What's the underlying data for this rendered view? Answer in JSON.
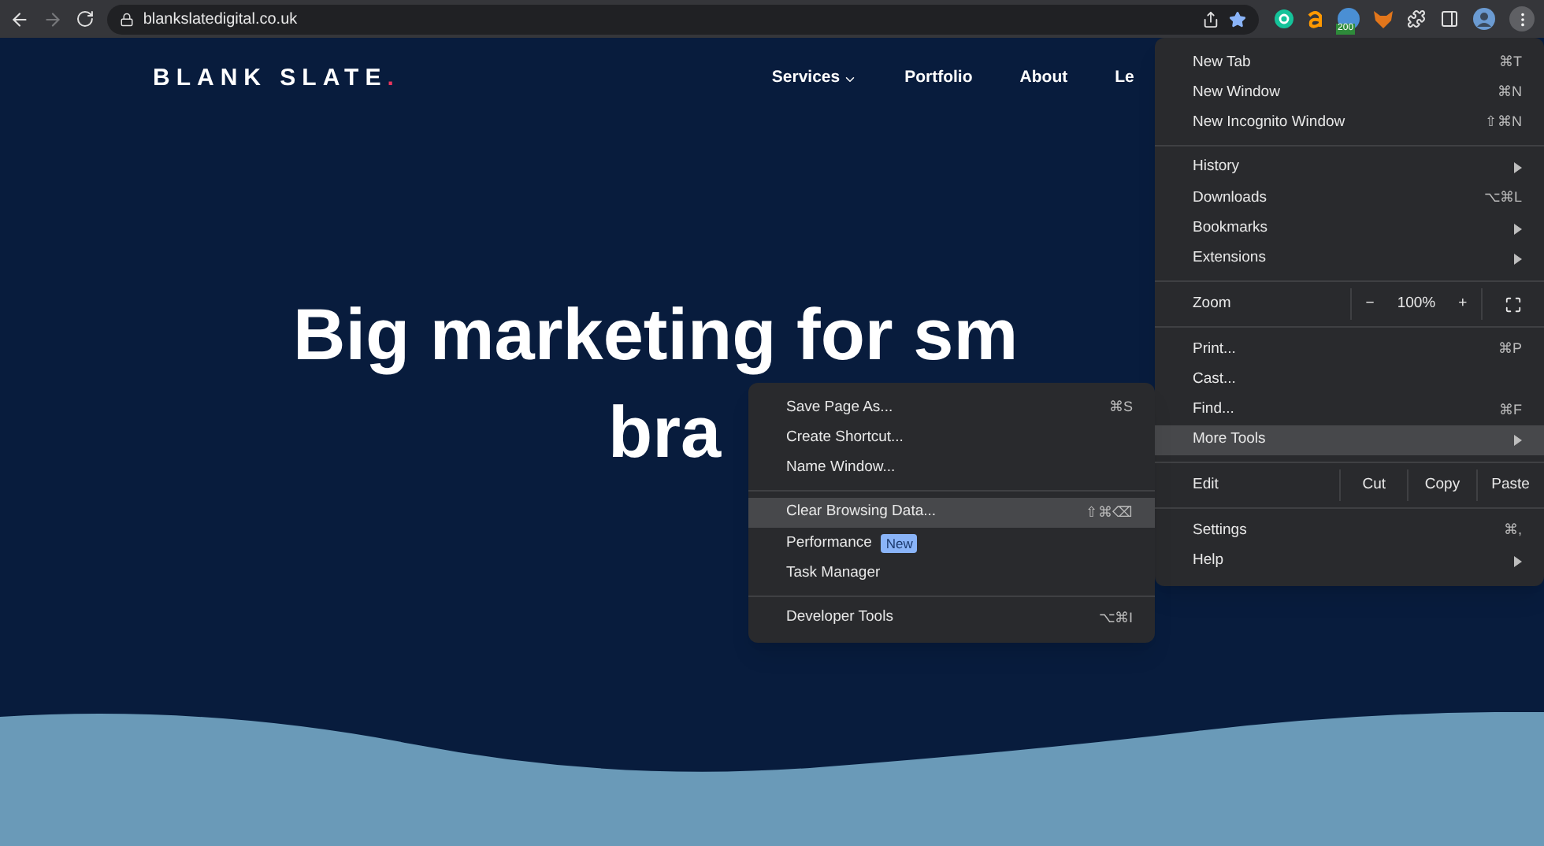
{
  "browser": {
    "url": "blankslatedigital.co.uk",
    "back_disabled": false,
    "forward_disabled": true,
    "extension_badge": "200"
  },
  "site": {
    "logo": "BLANK SLATE",
    "logo_dot": ".",
    "nav": [
      {
        "label": "Services",
        "dropdown": true
      },
      {
        "label": "Portfolio",
        "dropdown": false
      },
      {
        "label": "About",
        "dropdown": false
      },
      {
        "label": "Le",
        "dropdown": false
      }
    ],
    "headline": [
      "Big marketing for sm",
      "bra"
    ]
  },
  "menu": {
    "groups": [
      [
        {
          "kind": "item",
          "label": "New Tab",
          "shortcut": "⌘T",
          "submenu": false,
          "selected": false
        },
        {
          "kind": "item",
          "label": "New Window",
          "shortcut": "⌘N",
          "submenu": false,
          "selected": false
        },
        {
          "kind": "item",
          "label": "New Incognito Window",
          "shortcut": "⇧⌘N",
          "submenu": false,
          "selected": false
        }
      ],
      [
        {
          "kind": "item",
          "label": "History",
          "submenu": true,
          "selected": false
        },
        {
          "kind": "item",
          "label": "Downloads",
          "shortcut": "⌥⌘L",
          "submenu": false,
          "selected": false
        },
        {
          "kind": "item",
          "label": "Bookmarks",
          "submenu": true,
          "selected": false
        },
        {
          "kind": "item",
          "label": "Extensions",
          "submenu": true,
          "selected": false
        }
      ],
      [
        {
          "kind": "zoom",
          "label": "Zoom",
          "minus": "−",
          "value": "100%",
          "plus": "+"
        }
      ],
      [
        {
          "kind": "item",
          "label": "Print...",
          "shortcut": "⌘P",
          "submenu": false,
          "selected": false
        },
        {
          "kind": "item",
          "label": "Cast...",
          "submenu": false,
          "selected": false
        },
        {
          "kind": "item",
          "label": "Find...",
          "shortcut": "⌘F",
          "submenu": false,
          "selected": false
        },
        {
          "kind": "item",
          "label": "More Tools",
          "submenu": true,
          "selected": true
        }
      ],
      [
        {
          "kind": "edit",
          "label": "Edit",
          "buttons": [
            "Cut",
            "Copy",
            "Paste"
          ]
        }
      ],
      [
        {
          "kind": "item",
          "label": "Settings",
          "shortcut": "⌘,",
          "submenu": false,
          "selected": false
        },
        {
          "kind": "item",
          "label": "Help",
          "submenu": true,
          "selected": false
        }
      ]
    ]
  },
  "submenu": {
    "groups": [
      [
        {
          "kind": "item",
          "label": "Save Page As...",
          "shortcut": "⌘S",
          "selected": false
        },
        {
          "kind": "item",
          "label": "Create Shortcut...",
          "selected": false
        },
        {
          "kind": "item",
          "label": "Name Window...",
          "selected": false
        }
      ],
      [
        {
          "kind": "item",
          "label": "Clear Browsing Data...",
          "shortcut": "⇧⌘⌫",
          "selected": true
        },
        {
          "kind": "item",
          "label": "Performance",
          "badge": "New",
          "selected": false
        },
        {
          "kind": "item",
          "label": "Task Manager",
          "selected": false
        }
      ],
      [
        {
          "kind": "item",
          "label": "Developer Tools",
          "shortcut": "⌥⌘I",
          "selected": false
        }
      ]
    ]
  }
}
